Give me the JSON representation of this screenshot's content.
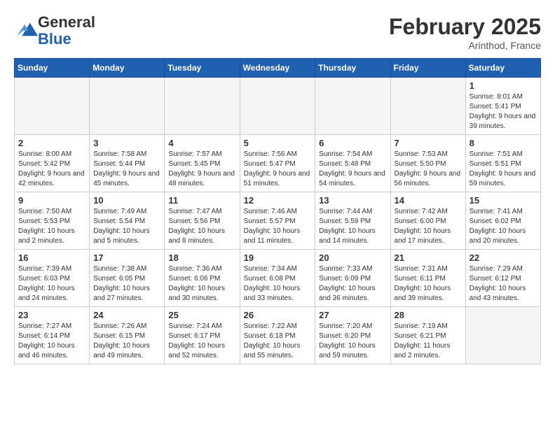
{
  "logo": {
    "general": "General",
    "blue": "Blue"
  },
  "header": {
    "month_year": "February 2025",
    "location": "Arinthod, France"
  },
  "weekdays": [
    "Sunday",
    "Monday",
    "Tuesday",
    "Wednesday",
    "Thursday",
    "Friday",
    "Saturday"
  ],
  "weeks": [
    [
      {
        "day": "",
        "info": ""
      },
      {
        "day": "",
        "info": ""
      },
      {
        "day": "",
        "info": ""
      },
      {
        "day": "",
        "info": ""
      },
      {
        "day": "",
        "info": ""
      },
      {
        "day": "",
        "info": ""
      },
      {
        "day": "1",
        "info": "Sunrise: 8:01 AM\nSunset: 5:41 PM\nDaylight: 9 hours and 39 minutes."
      }
    ],
    [
      {
        "day": "2",
        "info": "Sunrise: 8:00 AM\nSunset: 5:42 PM\nDaylight: 9 hours and 42 minutes."
      },
      {
        "day": "3",
        "info": "Sunrise: 7:58 AM\nSunset: 5:44 PM\nDaylight: 9 hours and 45 minutes."
      },
      {
        "day": "4",
        "info": "Sunrise: 7:57 AM\nSunset: 5:45 PM\nDaylight: 9 hours and 48 minutes."
      },
      {
        "day": "5",
        "info": "Sunrise: 7:56 AM\nSunset: 5:47 PM\nDaylight: 9 hours and 51 minutes."
      },
      {
        "day": "6",
        "info": "Sunrise: 7:54 AM\nSunset: 5:48 PM\nDaylight: 9 hours and 54 minutes."
      },
      {
        "day": "7",
        "info": "Sunrise: 7:53 AM\nSunset: 5:50 PM\nDaylight: 9 hours and 56 minutes."
      },
      {
        "day": "8",
        "info": "Sunrise: 7:51 AM\nSunset: 5:51 PM\nDaylight: 9 hours and 59 minutes."
      }
    ],
    [
      {
        "day": "9",
        "info": "Sunrise: 7:50 AM\nSunset: 5:53 PM\nDaylight: 10 hours and 2 minutes."
      },
      {
        "day": "10",
        "info": "Sunrise: 7:49 AM\nSunset: 5:54 PM\nDaylight: 10 hours and 5 minutes."
      },
      {
        "day": "11",
        "info": "Sunrise: 7:47 AM\nSunset: 5:56 PM\nDaylight: 10 hours and 8 minutes."
      },
      {
        "day": "12",
        "info": "Sunrise: 7:46 AM\nSunset: 5:57 PM\nDaylight: 10 hours and 11 minutes."
      },
      {
        "day": "13",
        "info": "Sunrise: 7:44 AM\nSunset: 5:59 PM\nDaylight: 10 hours and 14 minutes."
      },
      {
        "day": "14",
        "info": "Sunrise: 7:42 AM\nSunset: 6:00 PM\nDaylight: 10 hours and 17 minutes."
      },
      {
        "day": "15",
        "info": "Sunrise: 7:41 AM\nSunset: 6:02 PM\nDaylight: 10 hours and 20 minutes."
      }
    ],
    [
      {
        "day": "16",
        "info": "Sunrise: 7:39 AM\nSunset: 6:03 PM\nDaylight: 10 hours and 24 minutes."
      },
      {
        "day": "17",
        "info": "Sunrise: 7:38 AM\nSunset: 6:05 PM\nDaylight: 10 hours and 27 minutes."
      },
      {
        "day": "18",
        "info": "Sunrise: 7:36 AM\nSunset: 6:06 PM\nDaylight: 10 hours and 30 minutes."
      },
      {
        "day": "19",
        "info": "Sunrise: 7:34 AM\nSunset: 6:08 PM\nDaylight: 10 hours and 33 minutes."
      },
      {
        "day": "20",
        "info": "Sunrise: 7:33 AM\nSunset: 6:09 PM\nDaylight: 10 hours and 36 minutes."
      },
      {
        "day": "21",
        "info": "Sunrise: 7:31 AM\nSunset: 6:11 PM\nDaylight: 10 hours and 39 minutes."
      },
      {
        "day": "22",
        "info": "Sunrise: 7:29 AM\nSunset: 6:12 PM\nDaylight: 10 hours and 43 minutes."
      }
    ],
    [
      {
        "day": "23",
        "info": "Sunrise: 7:27 AM\nSunset: 6:14 PM\nDaylight: 10 hours and 46 minutes."
      },
      {
        "day": "24",
        "info": "Sunrise: 7:26 AM\nSunset: 6:15 PM\nDaylight: 10 hours and 49 minutes."
      },
      {
        "day": "25",
        "info": "Sunrise: 7:24 AM\nSunset: 6:17 PM\nDaylight: 10 hours and 52 minutes."
      },
      {
        "day": "26",
        "info": "Sunrise: 7:22 AM\nSunset: 6:18 PM\nDaylight: 10 hours and 55 minutes."
      },
      {
        "day": "27",
        "info": "Sunrise: 7:20 AM\nSunset: 6:20 PM\nDaylight: 10 hours and 59 minutes."
      },
      {
        "day": "28",
        "info": "Sunrise: 7:19 AM\nSunset: 6:21 PM\nDaylight: 11 hours and 2 minutes."
      },
      {
        "day": "",
        "info": ""
      }
    ]
  ]
}
